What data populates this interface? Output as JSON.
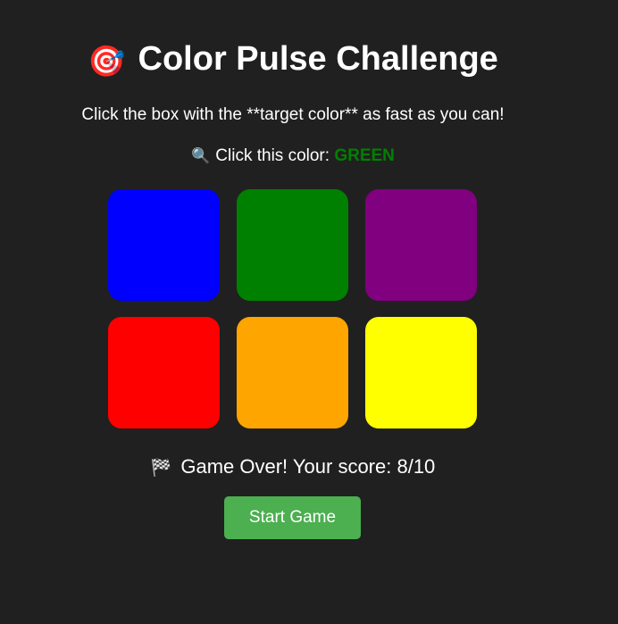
{
  "header": {
    "icon": "🎯",
    "title": "Color Pulse Challenge"
  },
  "instructions": "Click the box with the **target color** as fast as you can!",
  "target": {
    "icon": "🔍",
    "label": "Click this color: ",
    "color_name": "GREEN",
    "color_hex": "#008000"
  },
  "boxes": [
    {
      "color": "#0000ff"
    },
    {
      "color": "#008000"
    },
    {
      "color": "#800080"
    },
    {
      "color": "#ff0000"
    },
    {
      "color": "#ffa500"
    },
    {
      "color": "#ffff00"
    }
  ],
  "status": {
    "icon": "🏁",
    "text": "Game Over! Your score: 8/10"
  },
  "start_button_label": "Start Game"
}
